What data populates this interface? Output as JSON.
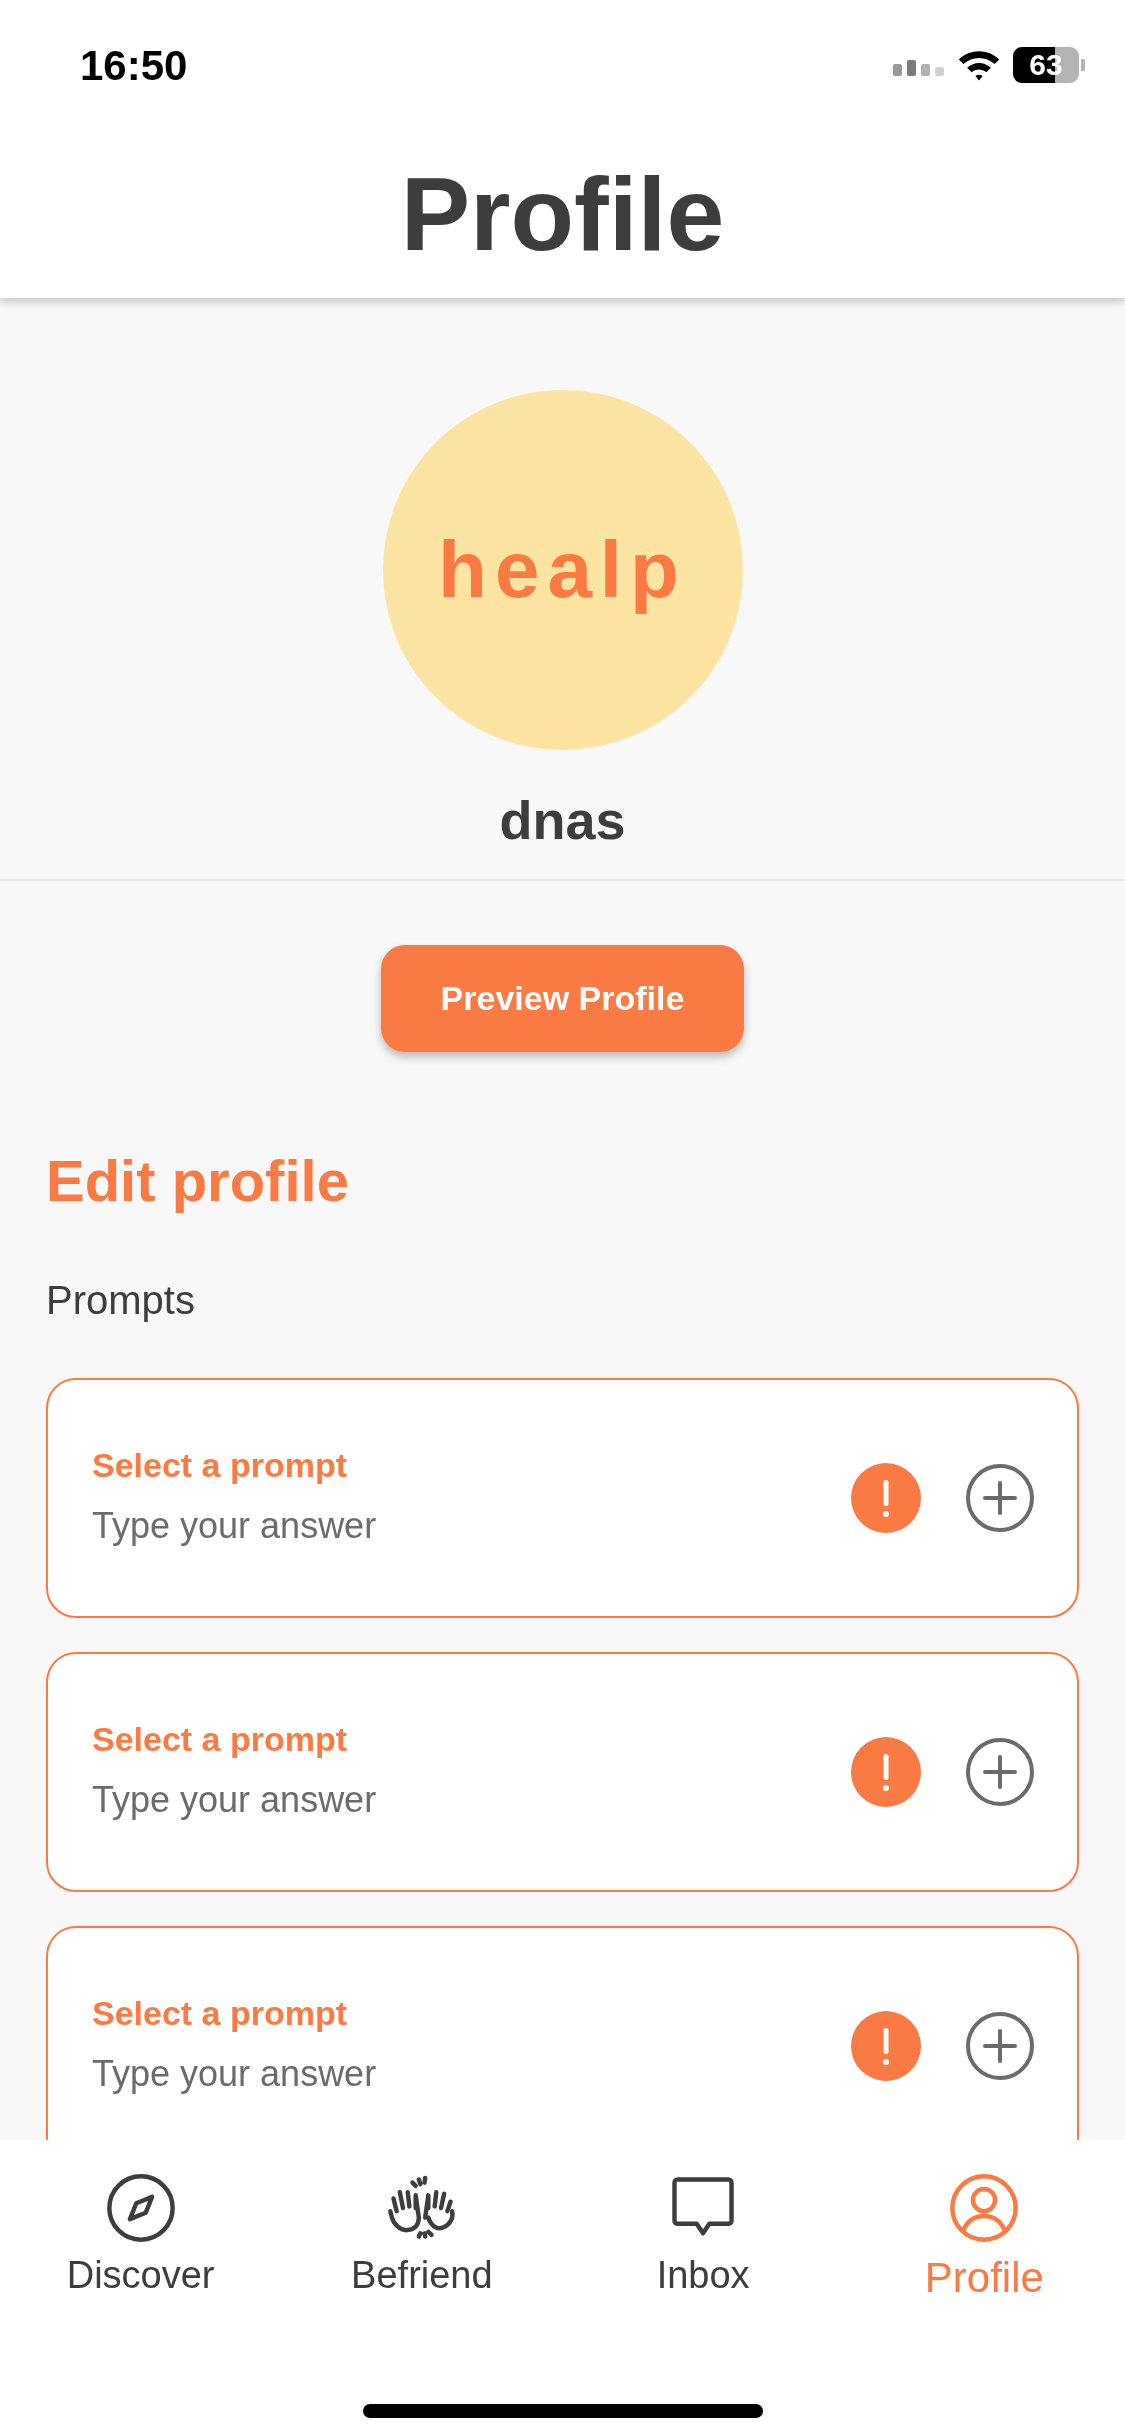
{
  "status_bar": {
    "time": "16:50",
    "battery": "63"
  },
  "header": {
    "title": "Profile"
  },
  "profile": {
    "avatar_text": "healp",
    "name": "dnas"
  },
  "preview_button": "Preview Profile",
  "section_title": "Edit profile",
  "prompts_label": "Prompts",
  "prompts": [
    {
      "title": "Select a prompt",
      "placeholder": "Type your answer"
    },
    {
      "title": "Select a prompt",
      "placeholder": "Type your answer"
    },
    {
      "title": "Select a prompt",
      "placeholder": "Type your answer"
    }
  ],
  "tabs": [
    {
      "kind": "compass",
      "label": "Discover",
      "selected": false
    },
    {
      "kind": "hands",
      "label": "Befriend",
      "selected": false
    },
    {
      "kind": "chat",
      "label": "Inbox",
      "selected": false
    },
    {
      "kind": "person",
      "label": "Profile",
      "selected": true
    }
  ]
}
